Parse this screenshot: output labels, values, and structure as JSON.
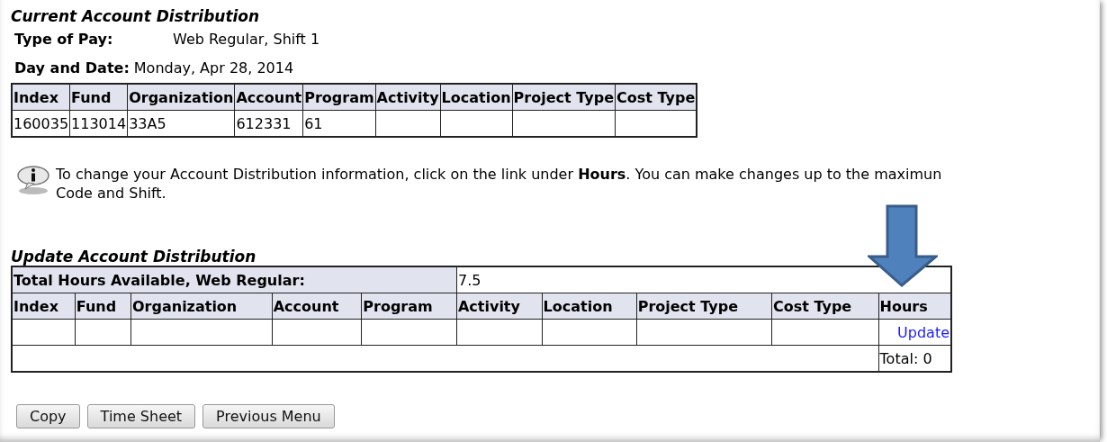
{
  "current": {
    "title": "Current Account Distribution",
    "type_of_pay": {
      "label": "Type of Pay:",
      "value": "Web Regular, Shift 1"
    },
    "day_and_date": {
      "label": "Day and Date:",
      "value": "Monday, Apr 28, 2014"
    },
    "columns": [
      "Index",
      "Fund",
      "Organization",
      "Account",
      "Program",
      "Activity",
      "Location",
      "Project Type",
      "Cost Type"
    ],
    "rows": [
      [
        "160035",
        "113014",
        "33A5",
        "612331",
        "61"
      ]
    ]
  },
  "info": {
    "lines": [
      "To change your Account Distribution information, click on the link under **Hours**. You can make changes up to the maximun",
      "Code and Shift."
    ]
  },
  "update": {
    "title": "Update Account Distribution",
    "total_hours": {
      "label": "Total Hours Available, Web Regular:",
      "value": "7.5"
    },
    "columns": [
      "Index",
      "Fund",
      "Organization",
      "Account",
      "Program",
      "Activity",
      "Location",
      "Project Type",
      "Cost Type",
      "Hours"
    ],
    "hours_link": "Update",
    "total": "Total: 0"
  },
  "buttons": [
    "Copy",
    "Time Sheet",
    "Previous Menu"
  ]
}
